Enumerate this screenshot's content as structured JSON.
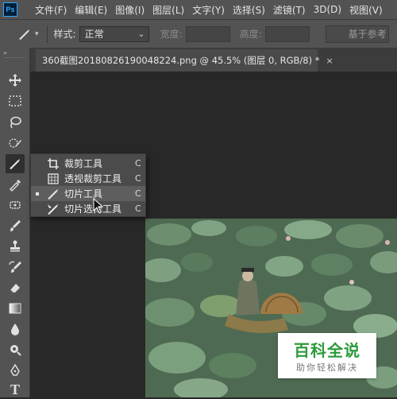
{
  "app": {
    "logo_text": "Ps"
  },
  "menu": [
    "文件(F)",
    "编辑(E)",
    "图像(I)",
    "图层(L)",
    "文字(Y)",
    "选择(S)",
    "滤镜(T)",
    "3D(D)",
    "视图(V)"
  ],
  "options_bar": {
    "tool_dropdown_arrow": "▾",
    "style_label": "样式:",
    "style_value": "正常",
    "select_arrow": "⌄",
    "width_label": "宽度:",
    "height_label": "高度:",
    "guides_button": "基于参考"
  },
  "tools_panel": {
    "collapse_glyph": "»",
    "type_tool_glyph": "T"
  },
  "document": {
    "tab_title": "360截图20180826190048224.png @ 45.5% (图层 0, RGB/8) *",
    "close_glyph": "×"
  },
  "flyout": {
    "items": [
      {
        "label": "裁剪工具",
        "shortcut": "C",
        "icon": "crop-icon"
      },
      {
        "label": "透视裁剪工具",
        "shortcut": "C",
        "icon": "perspective-crop-icon"
      },
      {
        "label": "切片工具",
        "shortcut": "C",
        "icon": "slice-icon",
        "selected": true
      },
      {
        "label": "切片选择工具",
        "shortcut": "C",
        "icon": "slice-select-icon"
      }
    ]
  },
  "watermark": {
    "title": "百科全说",
    "subtitle": "助你轻松解决"
  },
  "colors": {
    "menubar": "#535353",
    "canvas": "#282828",
    "watermark_green": "#2a9a3a"
  }
}
